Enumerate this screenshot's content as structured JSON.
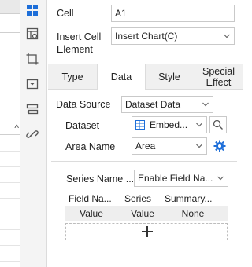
{
  "cell": {
    "label": "Cell",
    "value": "A1"
  },
  "insert_cell_element": {
    "label": "Insert Cell Element",
    "value": "Insert Chart(C)"
  },
  "tabs": [
    {
      "label": "Type",
      "active": false
    },
    {
      "label": "Data",
      "active": true
    },
    {
      "label": "Style",
      "active": false
    },
    {
      "label": "Special Effect",
      "active": false
    }
  ],
  "data_source": {
    "label": "Data Source",
    "value": "Dataset Data"
  },
  "dataset": {
    "label": "Dataset",
    "value": "Embed..."
  },
  "area_name": {
    "label": "Area Name",
    "value": "Area"
  },
  "series_name": {
    "label": "Series Name ...",
    "value": "Enable Field Na..."
  },
  "grid": {
    "headers": [
      "Field Na...",
      "Series",
      "Summary..."
    ],
    "row": [
      "Value",
      "Value",
      "None"
    ]
  },
  "add_label": "+",
  "sheet": {
    "collapse_glyph": "^"
  },
  "colors": {
    "accent": "#1e6fd9",
    "tab_bg": "#f0f0f0"
  }
}
